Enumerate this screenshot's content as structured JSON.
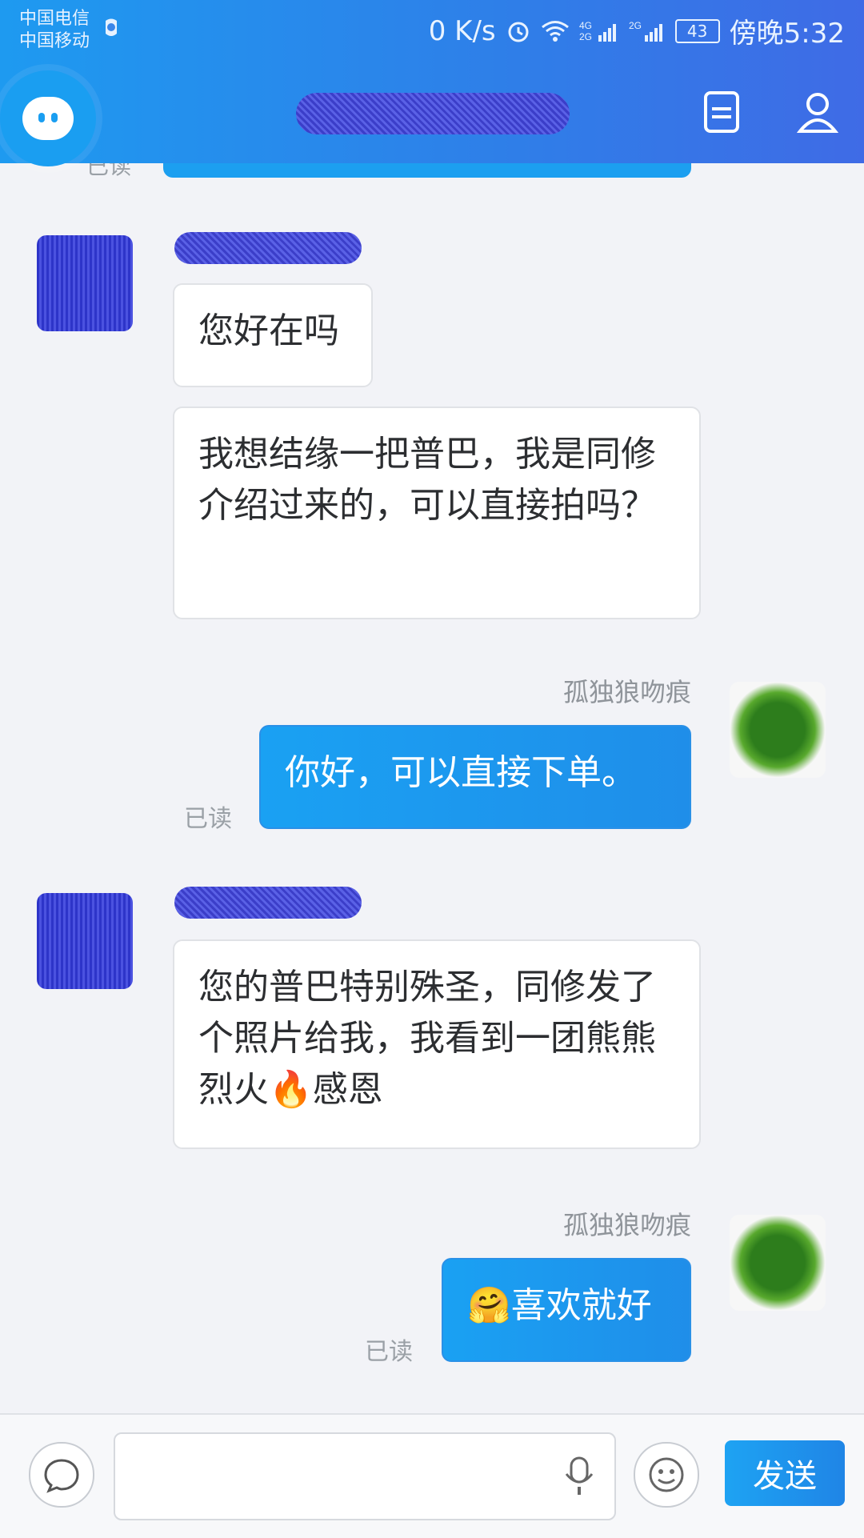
{
  "status_bar": {
    "carrier_1": "中国电信",
    "carrier_2": "中国移动",
    "speed": "0 K/s",
    "battery": "43",
    "time": "傍晚5:32",
    "icons": [
      "alarm-icon",
      "wifi-icon",
      "signal-icon",
      "signal-icon-2",
      "battery-icon"
    ]
  },
  "header": {
    "logo": "app-logo",
    "title_redacted": true,
    "right_icons": [
      "list-icon",
      "profile-icon"
    ]
  },
  "chat": {
    "previous": {
      "read_label": "已读"
    },
    "messages": [
      {
        "side": "left",
        "avatar": "avatar-left-redacted",
        "name_redacted": true,
        "bubbles": [
          "您好在吗",
          "我想结缘一把普巴，我是同修介绍过来的，可以直接拍吗？"
        ]
      },
      {
        "side": "right",
        "name": "孤独狼吻痕",
        "avatar": "avatar-right",
        "text": "你好，可以直接下单。",
        "read_label": "已读"
      },
      {
        "side": "left",
        "avatar": "avatar-left-redacted",
        "name_redacted": true,
        "text": "您的普巴特别殊圣，同修发了个照片给我，我看到一团熊熊烈火🔥感恩"
      },
      {
        "side": "right",
        "name": "孤独狼吻痕",
        "avatar": "avatar-right",
        "text": "🤗喜欢就好",
        "read_label": "已读"
      }
    ]
  },
  "input_bar": {
    "left_icon": "chat-bubble-icon",
    "mic_icon": "mic-icon",
    "emoji_icon": "emoji-icon",
    "send_label": "发送",
    "placeholder": ""
  },
  "colors": {
    "header_gradient_start": "#1e9af0",
    "header_gradient_end": "#3f6be6",
    "bubble_me": "#1f8ee9",
    "bubble_other": "#ffffff",
    "background": "#f2f3f7"
  }
}
